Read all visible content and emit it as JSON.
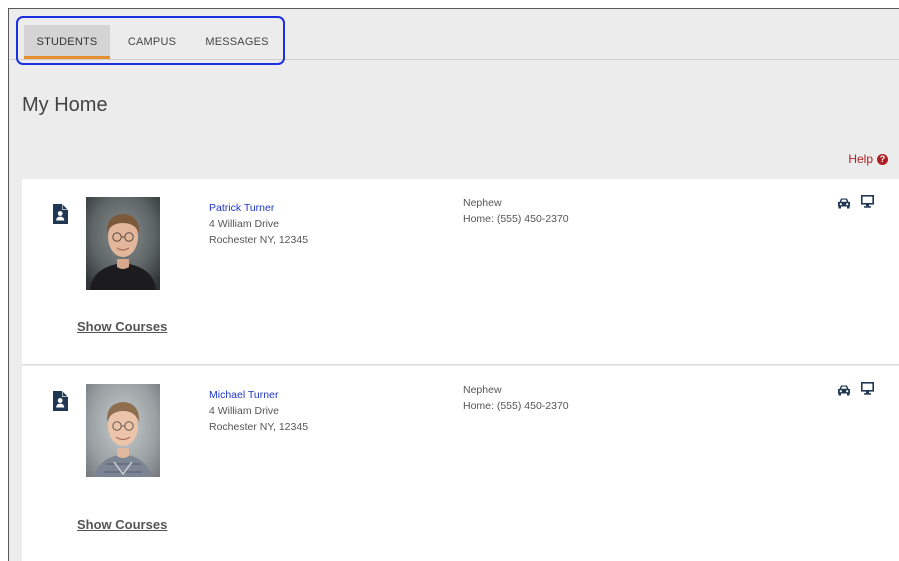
{
  "tabs": [
    {
      "label": "STUDENTS",
      "active": true
    },
    {
      "label": "CAMPUS",
      "active": false
    },
    {
      "label": "MESSAGES",
      "active": false
    }
  ],
  "page": {
    "title": "My Home",
    "help_label": "Help",
    "help_icon_glyph": "?"
  },
  "students": [
    {
      "name": "Patrick Turner",
      "address_line1": "4 William Drive",
      "address_line2": "Rochester NY, 12345",
      "relationship": "Nephew",
      "phone": "Home: (555) 450-2370",
      "show_courses_label": "Show Courses"
    },
    {
      "name": "Michael Turner",
      "address_line1": "4 William Drive",
      "address_line2": "Rochester NY, 12345",
      "relationship": "Nephew",
      "phone": "Home: (555) 450-2370",
      "show_courses_label": "Show Courses"
    }
  ],
  "icons": {
    "student_document": "id-document-icon",
    "transportation": "car-icon",
    "online": "monitor-icon",
    "help": "question-circle-icon"
  },
  "colors": {
    "tab_active_underline": "#e58e2e",
    "tab_highlight_outline": "#1b2fe0",
    "link_blue": "#1f36c7",
    "help_red": "#b01f24",
    "icon_navy": "#1f3752",
    "background": "#ececec"
  }
}
